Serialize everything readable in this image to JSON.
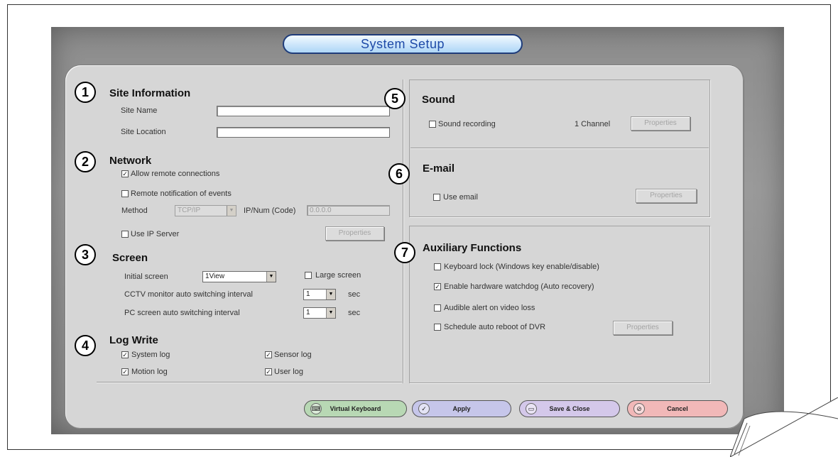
{
  "title": "System Setup",
  "sections": {
    "site": {
      "number": "1",
      "title": "Site Information",
      "site_name_label": "Site Name",
      "site_name_value": "",
      "site_location_label": "Site Location",
      "site_location_value": ""
    },
    "network": {
      "number": "2",
      "title": "Network",
      "allow_remote_label": "Allow remote connections",
      "allow_remote_checked": "✓",
      "remote_notification_label": "Remote notification of events",
      "method_label": "Method",
      "method_value": "TCP/IP",
      "ipnum_label": "IP/Num (Code)",
      "ipnum_value": "0.0.0.0",
      "use_ip_server_label": "Use IP Server",
      "properties_label": "Properties"
    },
    "screen": {
      "number": "3",
      "title": "Screen",
      "initial_screen_label": "Initial screen",
      "initial_screen_value": "1View",
      "large_screen_label": "Large screen",
      "cctv_label": "CCTV monitor auto switching interval",
      "cctv_value": "1",
      "pc_label": "PC screen auto switching interval",
      "pc_value": "1",
      "sec_label": "sec"
    },
    "log": {
      "number": "4",
      "title": "Log Write",
      "system_log_label": "System log",
      "sensor_log_label": "Sensor log",
      "motion_log_label": "Motion log",
      "user_log_label": "User log",
      "checked_mark": "✓"
    },
    "sound": {
      "number": "5",
      "title": "Sound",
      "recording_label": "Sound recording",
      "channel_label": "1 Channel",
      "properties_label": "Properties"
    },
    "email": {
      "number": "6",
      "title": "E-mail",
      "use_email_label": "Use email",
      "properties_label": "Properties"
    },
    "aux": {
      "number": "7",
      "title": "Auxiliary Functions",
      "keyboard_lock_label": "Keyboard lock (Windows key enable/disable)",
      "watchdog_label": "Enable hardware watchdog (Auto recovery)",
      "watchdog_checked": "✓",
      "audible_alert_label": "Audible alert on video loss",
      "auto_reboot_label": "Schedule auto reboot of DVR",
      "properties_label": "Properties"
    }
  },
  "buttons": {
    "virtual_keyboard": "Virtual Keyboard",
    "apply": "Apply",
    "save_close": "Save & Close",
    "cancel": "Cancel"
  },
  "icons": {
    "dropdown": "▼",
    "keyboard": "⌨",
    "apply": "✓",
    "save": "▭",
    "cancel": "⊘"
  },
  "colors": {
    "title_text": "#1e4aa8",
    "virtual_keyboard_bg": "#b8d8b4",
    "apply_bg": "#c6c6ea",
    "save_close_bg": "#d4c8ea",
    "cancel_bg": "#f1b8b8"
  }
}
